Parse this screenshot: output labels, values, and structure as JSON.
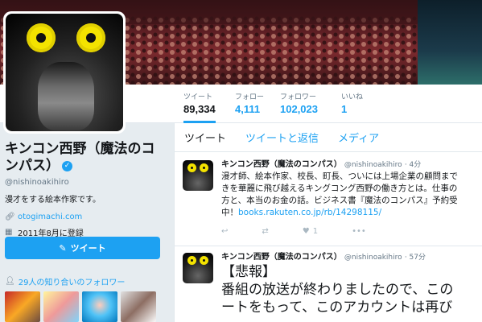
{
  "profile": {
    "name": "キンコン西野（魔法のコンパス）",
    "handle": "@nishinoakihiro",
    "bio": "漫才をする絵本作家です。",
    "website": "otogimachi.com",
    "joined": "2011年8月に登録",
    "tweet_button": "ツイート",
    "followers_you_know": "29人の知り合いのフォロワー",
    "verified_glyph": "✓",
    "accent_color": "#1da1f2"
  },
  "stats": [
    {
      "label": "ツイート",
      "value": "89,334"
    },
    {
      "label": "フォロー",
      "value": "4,111"
    },
    {
      "label": "フォロワー",
      "value": "102,023"
    },
    {
      "label": "いいね",
      "value": "1"
    }
  ],
  "tabs": [
    "ツイート",
    "ツイートと返信",
    "メディア"
  ],
  "tweets": [
    {
      "name": "キンコン西野（魔法のコンパス）",
      "handle": "@nishinoakihiro",
      "time": "· 4分",
      "lines": [
        "漫才師、絵本作家、校長、町長、ついには上場企業の顧問まで",
        "きを華麗に飛び越えるキングコング西野の働き方とは。仕事の",
        "方と、本当のお金の話。ビジネス書『魔法のコンパス』予約受"
      ],
      "last_line_prefix": "中！",
      "link": "books.rakuten.co.jp/rb/14298115/",
      "like_count": "1"
    },
    {
      "name": "キンコン西野（魔法のコンパス）",
      "handle": "@nishinoakihiro",
      "time": "· 57分",
      "lines": [
        "【悲報】",
        "番組の放送が終わりましたので、この",
        "ートをもって、このアカウントは再び"
      ]
    }
  ]
}
